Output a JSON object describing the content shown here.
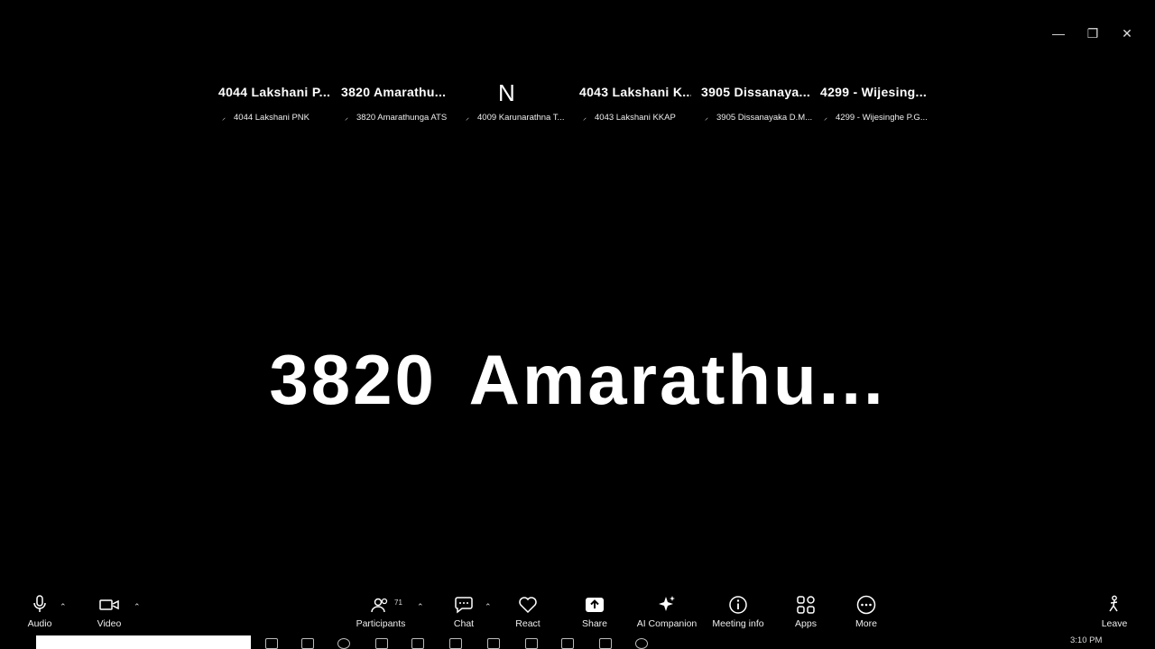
{
  "window_controls": {
    "minimize": "—",
    "restore": "❐",
    "close": "✕"
  },
  "gallery": [
    {
      "big": "4044 Lakshani P...",
      "small": "4044 Lakshani PNK"
    },
    {
      "big": "3820 Amarathu...",
      "small": "3820 Amarathunga ATS"
    },
    {
      "big": "N",
      "small": "4009 Karunarathna T..."
    },
    {
      "big": "4043 Lakshani K...",
      "small": "4043 Lakshani KKAP"
    },
    {
      "big": "3905 Dissanaya...",
      "small": "3905 Dissanayaka D.M..."
    },
    {
      "big": "4299 - Wijesing...",
      "small": "4299 - Wijesinghe P.G..."
    }
  ],
  "active_speaker": "3820 Amarathu...",
  "toolbar": {
    "audio": "Audio",
    "video": "Video",
    "participants": "Participants",
    "participants_count": "71",
    "chat": "Chat",
    "react": "React",
    "share": "Share",
    "ai_companion": "AI Companion",
    "meeting_info": "Meeting info",
    "apps": "Apps",
    "more": "More",
    "leave": "Leave",
    "caret": "⌃"
  },
  "taskbar": {
    "time": "3:10 PM"
  },
  "colors": {
    "background": "#000000",
    "text": "#ffffff"
  }
}
